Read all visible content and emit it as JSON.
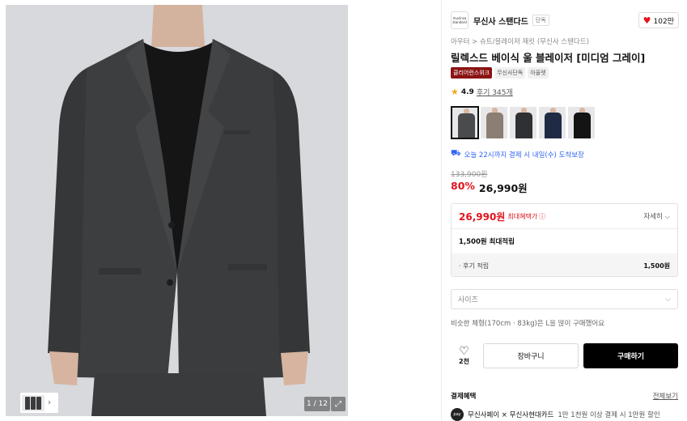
{
  "gallery": {
    "counter": "1 / 12",
    "thumb_icon": "thumbnail-strip",
    "next_icon": "chevron-right-icon",
    "expand_icon": "expand-icon",
    "jacket_color": "#3f4042",
    "background_color": "#d8d9dc"
  },
  "brand": {
    "logo_text": "musinsa standard",
    "name": "무신사 스탠다드",
    "tag": "단독"
  },
  "likes": {
    "count": "102만",
    "icon": "heart-icon"
  },
  "breadcrumb": "아우터 > 슈트/블레이저 재킷 (무신사 스탠다드)",
  "product": {
    "title": "릴렉스드 베이식 울 블레이저 [미디엄 그레이]",
    "badges": [
      "클리어런스위크",
      "무신사단독",
      "아울렛"
    ]
  },
  "rating": {
    "score": "4.9",
    "reviews": "후기 345개"
  },
  "colors": [
    {
      "name": "medium grey",
      "hex": "#4a4b4d",
      "selected": true
    },
    {
      "name": "beige",
      "hex": "#8a7f72",
      "selected": false
    },
    {
      "name": "charcoal",
      "hex": "#2e3033",
      "selected": false
    },
    {
      "name": "navy",
      "hex": "#1f2a44",
      "selected": false
    },
    {
      "name": "black",
      "hex": "#141414",
      "selected": false
    }
  ],
  "delivery": "오늘 22시까지 결제 시 내일(수) 도착보장",
  "price": {
    "original": "133,900원",
    "discount": "80%",
    "sale": "26,990원"
  },
  "benefit": {
    "price": "26,990원",
    "label": "최대혜택가",
    "detail": "자세히",
    "points": "1,500원 최대적립",
    "review_label": "· 후기 적립",
    "review_amount": "1,500원"
  },
  "size": {
    "placeholder": "사이즈",
    "hint": "비슷한 체형(170cm · 83kg)은 L을 많이 구매했어요"
  },
  "actions": {
    "wish_count": "2천",
    "cart": "장바구니",
    "buy": "구매하기"
  },
  "payment": {
    "title": "결제혜택",
    "all": "전체보기",
    "logo_text": "pay",
    "name": "무신사페이 × 무신사현대카드",
    "desc": "1만 1천원 이상 결제 시 1만원 할인"
  }
}
